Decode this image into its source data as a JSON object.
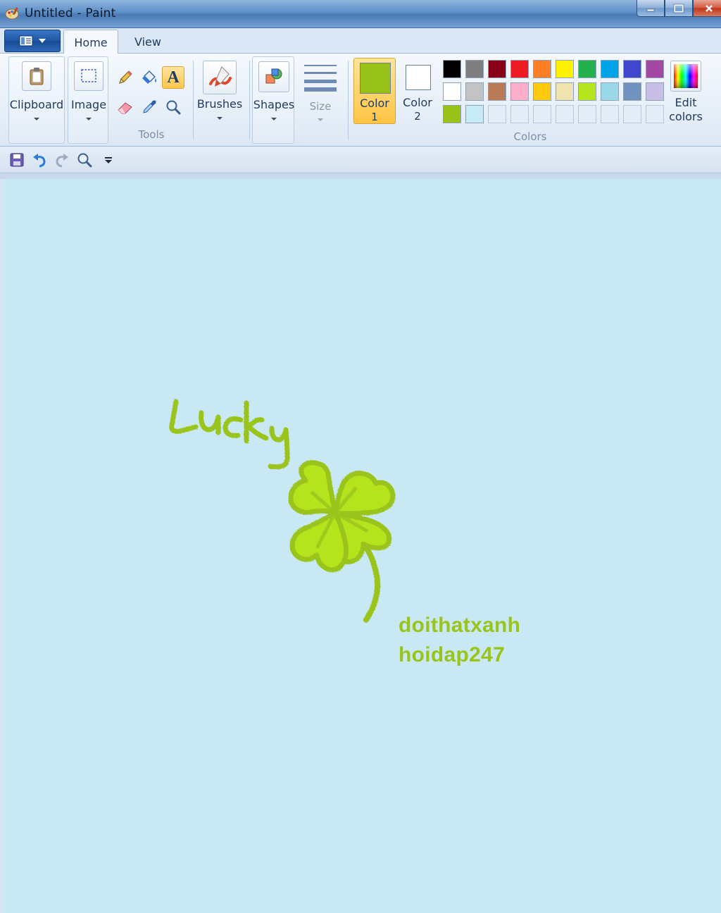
{
  "window": {
    "title": "Untitled - Paint"
  },
  "tabs": [
    {
      "label": "Home",
      "active": true
    },
    {
      "label": "View",
      "active": false
    }
  ],
  "ribbon": {
    "clipboard_label": "Clipboard",
    "image_label": "Image",
    "tools_group_label": "Tools",
    "brushes_label": "Brushes",
    "shapes_label": "Shapes",
    "size_label": "Size",
    "color1_label_line1": "Color",
    "color1_label_line2": "1",
    "color2_label_line1": "Color",
    "color2_label_line2": "2",
    "colors_group_label": "Colors",
    "edit_colors_line1": "Edit",
    "edit_colors_line2": "colors",
    "active_tool": "text"
  },
  "colors": {
    "color1": "#99c219",
    "color2": "#ffffff",
    "palette_row1": [
      "#000000",
      "#7f7f7f",
      "#880015",
      "#ed1c24",
      "#ff7f27",
      "#fff200",
      "#22b14c",
      "#00a2e8",
      "#3f48cc",
      "#a349a4"
    ],
    "palette_row2": [
      "#ffffff",
      "#c3c3c3",
      "#b97a57",
      "#ffaec9",
      "#ffc90e",
      "#efe4b0",
      "#b5e61d",
      "#99d9ea",
      "#7092be",
      "#c8bfe7"
    ],
    "palette_row3": [
      "#99c219",
      "#c8ecf5",
      "",
      "",
      "",
      "",
      "",
      "",
      "",
      ""
    ]
  },
  "canvas": {
    "background": "#c8e9f3",
    "drawing_color": "#9ac31c",
    "handwritten_word": "Lucky",
    "text_line1": "doithatxanh",
    "text_line2": "hoidap247"
  }
}
